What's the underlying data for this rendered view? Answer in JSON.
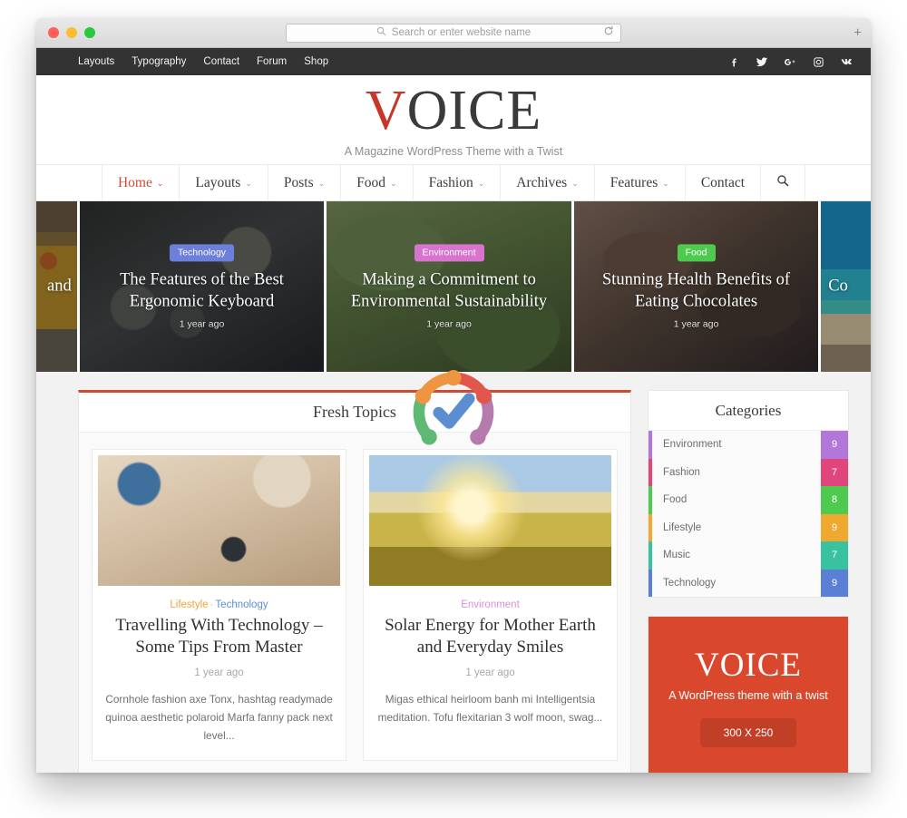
{
  "browser": {
    "url_placeholder": "Search or enter website name",
    "search_icon": "search-icon",
    "reload_icon": "reload-icon",
    "newtab_label": "+"
  },
  "topbar": {
    "menu": [
      {
        "label": "Layouts"
      },
      {
        "label": "Typography"
      },
      {
        "label": "Contact"
      },
      {
        "label": "Forum"
      },
      {
        "label": "Shop"
      }
    ],
    "social": [
      {
        "name": "facebook-icon",
        "glyph": "f"
      },
      {
        "name": "twitter-icon",
        "glyph": "✆"
      },
      {
        "name": "google-plus-icon",
        "glyph": "G+"
      },
      {
        "name": "instagram-icon",
        "glyph": "▣"
      },
      {
        "name": "vk-icon",
        "glyph": "vk"
      }
    ],
    "background": "#333333"
  },
  "logo": {
    "letter_v": "V",
    "rest": "OICE",
    "tagline": "A Magazine WordPress Theme with a Twist",
    "v_red": "#c9352a",
    "v_gray": "#8b8b8b"
  },
  "nav": {
    "items": [
      {
        "label": "Home",
        "caret": "⌄",
        "active": true
      },
      {
        "label": "Layouts",
        "caret": "⌄",
        "active": false
      },
      {
        "label": "Posts",
        "caret": "⌄",
        "active": false
      },
      {
        "label": "Food",
        "caret": "⌄",
        "active": false
      },
      {
        "label": "Fashion",
        "caret": "⌄",
        "active": false
      },
      {
        "label": "Archives",
        "caret": "⌄",
        "active": false
      },
      {
        "label": "Features",
        "caret": "⌄",
        "active": false
      },
      {
        "label": "Contact",
        "caret": "",
        "active": false
      }
    ],
    "search_icon": "search-icon",
    "active_color": "#d04a32"
  },
  "slider": {
    "partial_left": {
      "title_fragment": "and"
    },
    "partial_right": {
      "title_fragment": "Co"
    },
    "slides": [
      {
        "badge": "Technology",
        "badge_color": "#6b7fdb",
        "title": "The Features of the Best Ergonomic Keyboard",
        "date": "1 year ago"
      },
      {
        "badge": "Environment",
        "badge_color": "#d874cd",
        "title": "Making a Commitment to Environmental Sustainability",
        "date": "1 year ago"
      },
      {
        "badge": "Food",
        "badge_color": "#4ecb4e",
        "title": "Stunning Health Benefits of Eating Chocolates",
        "date": "1 year ago"
      }
    ]
  },
  "fresh_topics": {
    "title": "Fresh Topics",
    "accent_color": "#d04a32",
    "cards": [
      {
        "categories": [
          {
            "label": "Lifestyle",
            "color": "#e8a838"
          },
          {
            "label": "Technology",
            "color": "#5b8fd4"
          }
        ],
        "separator": "·",
        "title": "Travelling With Technology – Some Tips From Master",
        "date": "1 year ago",
        "excerpt": "Cornhole fashion axe Tonx, hashtag readymade quinoa aesthetic polaroid Marfa fanny pack next level..."
      },
      {
        "categories": [
          {
            "label": "Environment",
            "color": "#d890d8"
          }
        ],
        "separator": "",
        "title": "Solar Energy for Mother Earth and Everyday Smiles",
        "date": "1 year ago",
        "excerpt": "Migas ethical heirloom banh mi Intelligentsia meditation. Tofu flexitarian 3 wolf moon, swag..."
      }
    ],
    "pager": {
      "prev_label": "‹",
      "next_label": "›",
      "color": "#d9472c"
    }
  },
  "sidebar": {
    "categories_widget": {
      "title": "Categories",
      "items": [
        {
          "label": "Environment",
          "count": "9",
          "color": "#b377d9"
        },
        {
          "label": "Fashion",
          "count": "7",
          "color": "#e0457b"
        },
        {
          "label": "Food",
          "count": "8",
          "color": "#4ecb4e"
        },
        {
          "label": "Lifestyle",
          "count": "9",
          "color": "#f0a930"
        },
        {
          "label": "Music",
          "count": "7",
          "color": "#39c2a0"
        },
        {
          "label": "Technology",
          "count": "9",
          "color": "#5b7fd4"
        }
      ]
    },
    "ad": {
      "logo": "VOICE",
      "tagline": "A WordPress theme with a twist",
      "size_label": "300 X 250",
      "background": "#d9472c"
    }
  },
  "overlay_logo": {
    "name": "check-circle-logo",
    "segment_colors": [
      "#ef9541",
      "#e2574c",
      "#b57bad",
      "#5fb974",
      "#ef9541"
    ],
    "check_color": "#5b8ed0"
  }
}
